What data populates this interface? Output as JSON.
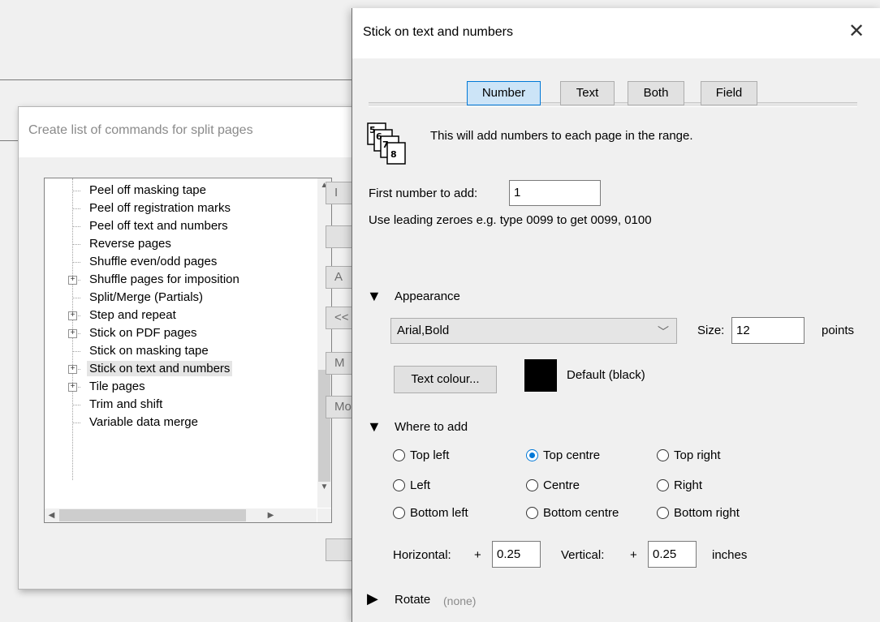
{
  "left_dialog": {
    "title": "Create list of commands for split pages",
    "tree_items": [
      {
        "label": "Peel off masking tape",
        "expandable": false,
        "selected": false
      },
      {
        "label": "Peel off registration marks",
        "expandable": false,
        "selected": false
      },
      {
        "label": "Peel off text and numbers",
        "expandable": false,
        "selected": false
      },
      {
        "label": "Reverse pages",
        "expandable": false,
        "selected": false
      },
      {
        "label": "Shuffle even/odd pages",
        "expandable": false,
        "selected": false
      },
      {
        "label": "Shuffle pages for imposition",
        "expandable": true,
        "selected": false
      },
      {
        "label": "Split/Merge (Partials)",
        "expandable": false,
        "selected": false
      },
      {
        "label": "Step and repeat",
        "expandable": true,
        "selected": false
      },
      {
        "label": "Stick on PDF pages",
        "expandable": true,
        "selected": false
      },
      {
        "label": "Stick on masking tape",
        "expandable": false,
        "selected": false
      },
      {
        "label": "Stick on text and numbers",
        "expandable": true,
        "selected": true
      },
      {
        "label": "Tile pages",
        "expandable": true,
        "selected": false
      },
      {
        "label": "Trim and shift",
        "expandable": false,
        "selected": false
      },
      {
        "label": "Variable data merge",
        "expandable": false,
        "selected": false
      }
    ],
    "partial_buttons": [
      "I",
      "",
      "A",
      "<<",
      "M",
      "Mo",
      ""
    ]
  },
  "dialog": {
    "title": "Stick on text and numbers",
    "close_glyph": "✕",
    "mode_buttons": [
      "Number",
      "Text",
      "Both",
      "Field"
    ],
    "active_mode": "Number",
    "info_text": "This will add numbers to each page in the range.",
    "first_number_label": "First number to add:",
    "first_number_value": "1",
    "hint": "Use leading zeroes e.g. type 0099 to get 0099, 0100",
    "appearance": {
      "label": "Appearance",
      "font": "Arial,Bold",
      "size_label": "Size:",
      "size_value": "12",
      "size_unit": "points",
      "colour_button": "Text colour...",
      "colour_label": "Default (black)",
      "colour_value": "#000000"
    },
    "where": {
      "label": "Where to add",
      "options": [
        [
          "Top left",
          "Top centre",
          "Top right"
        ],
        [
          "Left",
          "Centre",
          "Right"
        ],
        [
          "Bottom left",
          "Bottom centre",
          "Bottom right"
        ]
      ],
      "selected": "Top centre",
      "horizontal_label": "Horizontal:",
      "vertical_label": "Vertical:",
      "plus": "+",
      "horizontal_value": "0.25",
      "vertical_value": "0.25",
      "unit": "inches"
    },
    "rotate": {
      "label": "Rotate",
      "value": "(none)"
    }
  },
  "colors": {
    "accent": "#0078d7",
    "active_button_bg": "#cce4f7"
  }
}
